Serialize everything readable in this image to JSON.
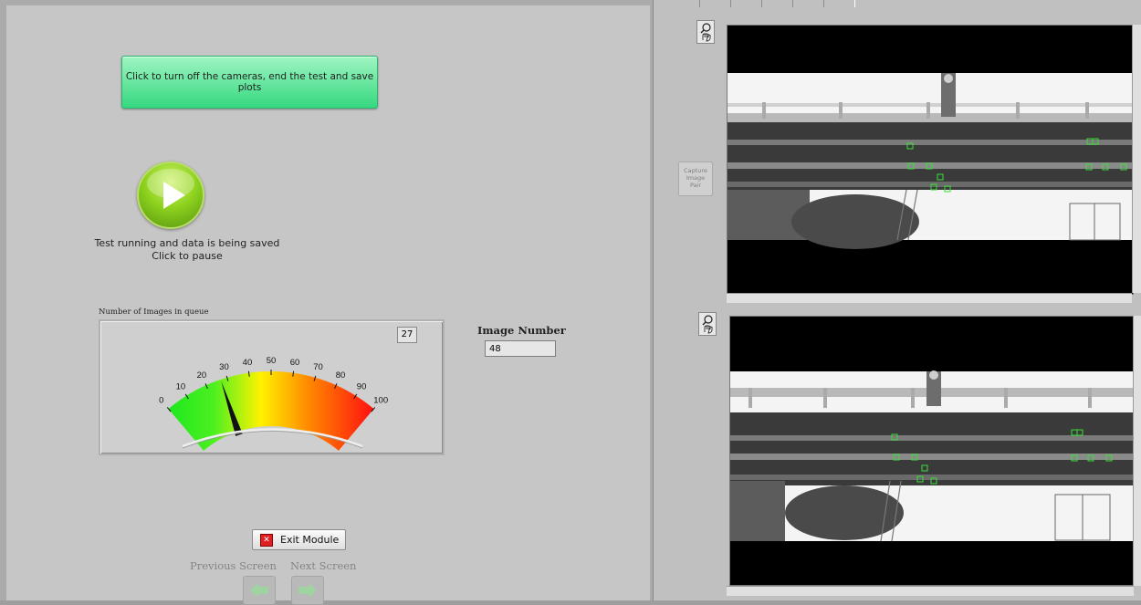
{
  "left_panel": {
    "end_test_button_label": "Click to turn off the cameras, end the test and save plots",
    "status_line1": "Test running and data is being saved",
    "status_line2": "Click to pause",
    "queue_label": "Number of Images in queue",
    "queue": {
      "value": 27,
      "min": 0,
      "max": 100,
      "ticks": [
        "0",
        "10",
        "20",
        "30",
        "40",
        "50",
        "60",
        "70",
        "80",
        "90",
        "100"
      ]
    },
    "image_number_label": "Image Number",
    "image_number_value": "48",
    "exit_button_label": "Exit Module",
    "previous_screen_label": "Previous Screen",
    "next_screen_label": "Next Screen"
  },
  "right_panel": {
    "capture_button_line1": "Capture",
    "capture_button_line2": "Image",
    "capture_button_line3": "Pair",
    "zoom_tool_icon": "zoom-hand-icon"
  },
  "colors": {
    "gauge_low": "#1ee81e",
    "gauge_mid": "#fff200",
    "gauge_high": "#ff1010",
    "tracking_markers": "#38e038",
    "end_button": "#4fe08e"
  }
}
